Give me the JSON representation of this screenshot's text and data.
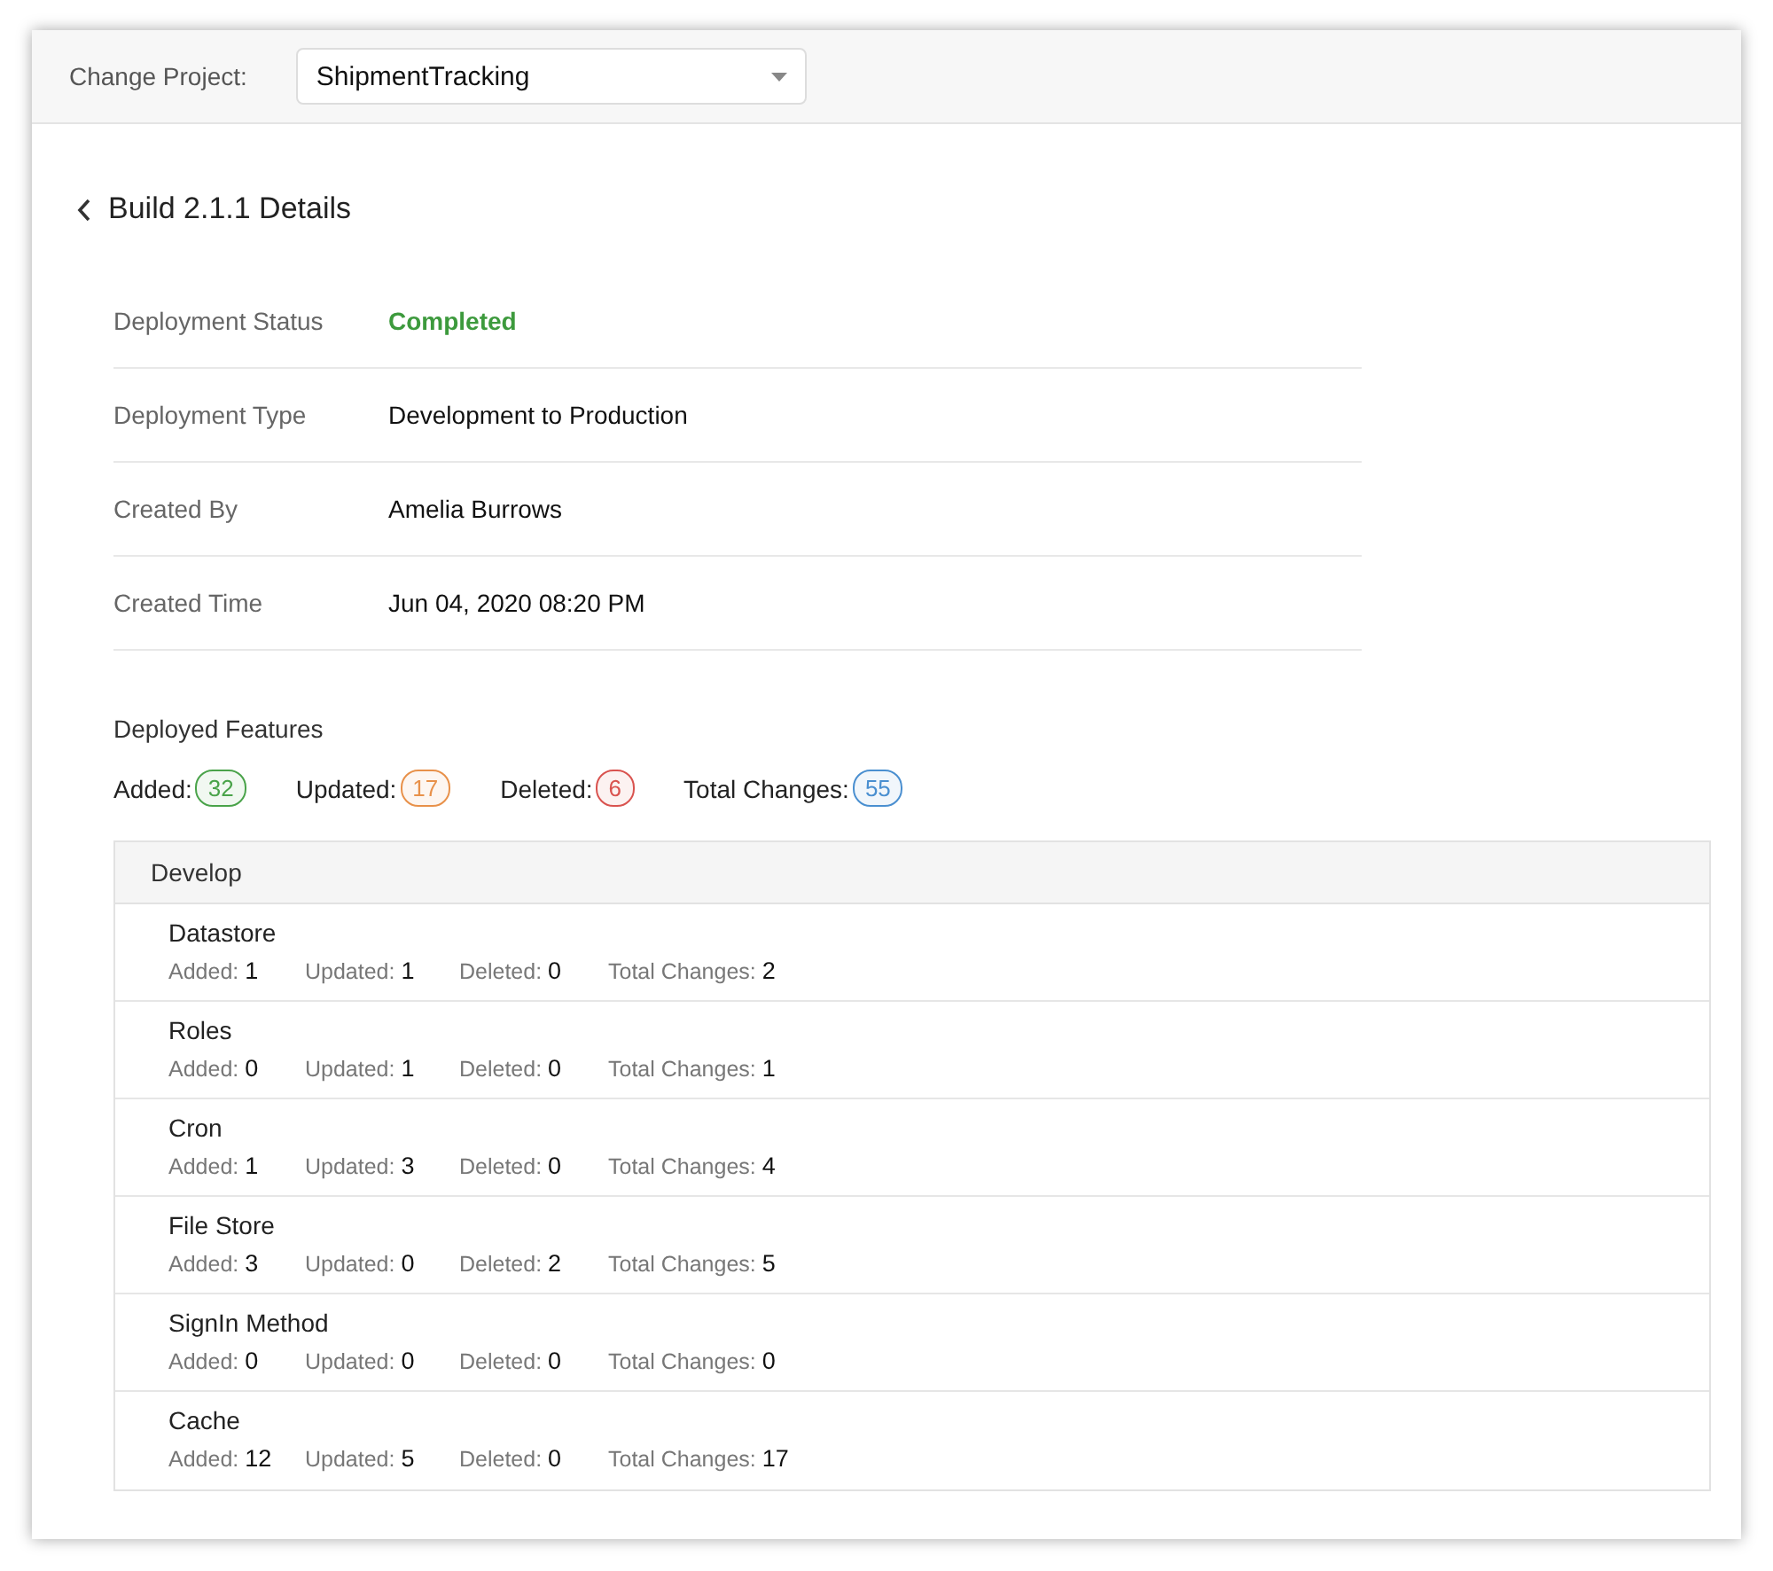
{
  "top_bar": {
    "label": "Change Project:",
    "project_select": {
      "value": "ShipmentTracking"
    }
  },
  "title": "Build 2.1.1 Details",
  "details": [
    {
      "label": "Deployment Status",
      "value": "Completed",
      "color": "#3d9a3d"
    },
    {
      "label": "Deployment Type",
      "value": "Development to Production",
      "color": "#111111"
    },
    {
      "label": "Created By",
      "value": "Amelia Burrows",
      "color": "#111111"
    },
    {
      "label": "Created Time",
      "value": "Jun 04, 2020 08:20 PM",
      "color": "#111111"
    }
  ],
  "features_heading": "Deployed Features",
  "summary": [
    {
      "label": "Added:",
      "count": "32",
      "color": "#4aa34a"
    },
    {
      "label": "Updated:",
      "count": "17",
      "color": "#e8914a"
    },
    {
      "label": "Deleted:",
      "count": "6",
      "color": "#d9534f"
    },
    {
      "label": "Total Changes:",
      "count": "55",
      "color": "#4a8fd0"
    }
  ],
  "group": {
    "title": "Develop",
    "features": [
      {
        "name": "Datastore",
        "stats": [
          {
            "label": "Added:",
            "value": "1"
          },
          {
            "label": "Updated:",
            "value": "1"
          },
          {
            "label": "Deleted:",
            "value": "0"
          },
          {
            "label": "Total Changes:",
            "value": "2"
          }
        ]
      },
      {
        "name": "Roles",
        "stats": [
          {
            "label": "Added:",
            "value": "0"
          },
          {
            "label": "Updated:",
            "value": "1"
          },
          {
            "label": "Deleted:",
            "value": "0"
          },
          {
            "label": "Total Changes:",
            "value": "1"
          }
        ]
      },
      {
        "name": "Cron",
        "stats": [
          {
            "label": "Added:",
            "value": "1"
          },
          {
            "label": "Updated:",
            "value": "3"
          },
          {
            "label": "Deleted:",
            "value": "0"
          },
          {
            "label": "Total Changes:",
            "value": "4"
          }
        ]
      },
      {
        "name": "File Store",
        "stats": [
          {
            "label": "Added:",
            "value": "3"
          },
          {
            "label": "Updated:",
            "value": "0"
          },
          {
            "label": "Deleted:",
            "value": "2"
          },
          {
            "label": "Total Changes:",
            "value": "5"
          }
        ]
      },
      {
        "name": "SignIn Method",
        "stats": [
          {
            "label": "Added:",
            "value": "0"
          },
          {
            "label": "Updated:",
            "value": "0"
          },
          {
            "label": "Deleted:",
            "value": "0"
          },
          {
            "label": "Total Changes:",
            "value": "0"
          }
        ]
      },
      {
        "name": "Cache",
        "stats": [
          {
            "label": "Added:",
            "value": "12"
          },
          {
            "label": "Updated:",
            "value": "5"
          },
          {
            "label": "Deleted:",
            "value": "0"
          },
          {
            "label": "Total Changes:",
            "value": "17"
          }
        ]
      }
    ]
  }
}
